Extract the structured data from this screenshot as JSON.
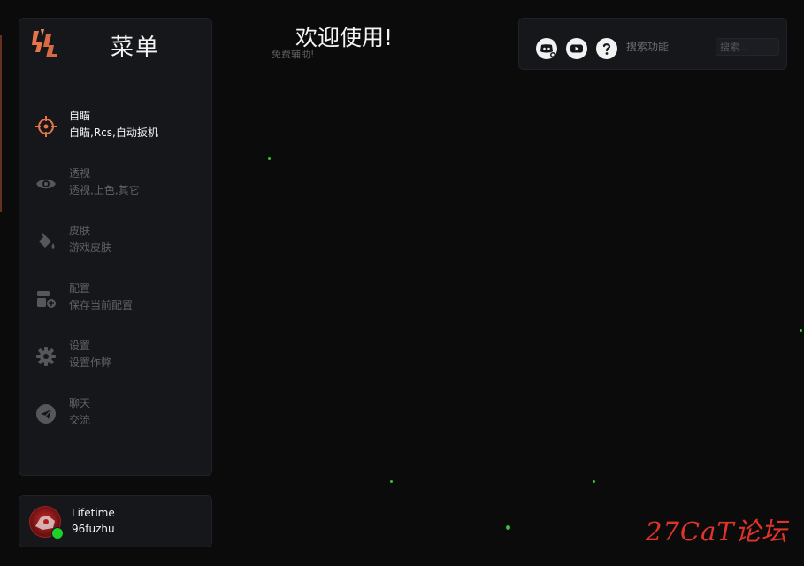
{
  "sidebar": {
    "title": "菜单",
    "items": [
      {
        "label": "自瞄",
        "sub": "自瞄,Rcs,自动扳机",
        "icon": "crosshair-icon",
        "active": true
      },
      {
        "label": "透视",
        "sub": "透视,上色,其它",
        "icon": "eye-icon",
        "active": false
      },
      {
        "label": "皮肤",
        "sub": "游戏皮肤",
        "icon": "paint-bucket-icon",
        "active": false
      },
      {
        "label": "配置",
        "sub": "保存当前配置",
        "icon": "config-add-icon",
        "active": false
      },
      {
        "label": "设置",
        "sub": "设置作弊",
        "icon": "gear-icon",
        "active": false
      },
      {
        "label": "聊天",
        "sub": "交流",
        "icon": "paper-plane-icon",
        "active": false
      }
    ]
  },
  "user": {
    "plan": "Lifetime",
    "name": "96fuzhu",
    "status_color": "#1ed02a"
  },
  "main": {
    "title": "欢迎使用!",
    "subtitle": "免费辅助!"
  },
  "topbar": {
    "icons": [
      "discord-icon",
      "youtube-icon",
      "help-icon"
    ],
    "search_label": "搜索功能",
    "search_placeholder": "搜索..."
  },
  "watermark": "27CaT论坛",
  "colors": {
    "accent": "#e9744a",
    "panel": "#16171b",
    "background": "#0b0b0c",
    "muted": "#5f6168"
  }
}
